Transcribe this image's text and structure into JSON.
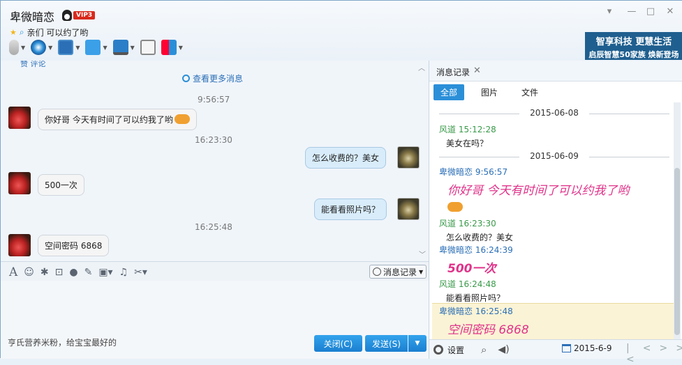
{
  "window": {
    "contact_name": "卑微暗恋",
    "vip_badge": "VIP3",
    "signature": "亲们 可以约了哟",
    "controls": [
      "▾",
      "—",
      "□",
      "✕"
    ]
  },
  "toolbar": {
    "icons": [
      "microphone-icon",
      "video-call-icon",
      "screen-share-icon",
      "file-transfer-icon",
      "remote-desktop-icon",
      "add-app-icon",
      "more-apps-icon"
    ]
  },
  "ad_banner": {
    "line1": "智享科技 更慧生活",
    "line2": "启辰智慧50家族 焕新登场"
  },
  "chat": {
    "top_cut": "赞    评论",
    "view_more": "查看更多消息",
    "messages": [
      {
        "time": "9:56:57"
      },
      {
        "side": "left",
        "text": "你好哥  今天有时间了可以约我了哟"
      },
      {
        "time": "16:23:30"
      },
      {
        "side": "right",
        "text": "怎么收费的？美女"
      },
      {
        "side": "left",
        "text": "500一次"
      },
      {
        "side": "right",
        "text": "能看看照片吗？"
      },
      {
        "time": "16:25:48"
      },
      {
        "side": "left",
        "text": "空间密码  6868"
      }
    ]
  },
  "input_toolbar": {
    "icons": [
      "font-icon",
      "emoji-icon",
      "magic-icon",
      "screenshot-icon",
      "voice-icon",
      "edit-icon",
      "image-icon",
      "music-icon",
      "scissors-icon"
    ],
    "history_button": "消息记录"
  },
  "input_area": {
    "ad_text": "亨氏营养米粉，给宝宝最好的",
    "close_button": "关闭(C)",
    "send_button": "发送(S)"
  },
  "history_panel": {
    "tab_label": "消息记录",
    "filters": [
      "全部",
      "图片",
      "文件"
    ],
    "entries": [
      {
        "type": "date",
        "text": "2015-06-08"
      },
      {
        "type": "name",
        "color": "green",
        "text": "风道 15:12:28"
      },
      {
        "type": "msg",
        "text": "美女在吗？"
      },
      {
        "type": "date",
        "text": "2015-06-09"
      },
      {
        "type": "name",
        "color": "blue",
        "text": "卑微暗恋 9:56:57"
      },
      {
        "type": "big",
        "text": "你好哥 今天有时间了可以约我了哟"
      },
      {
        "type": "name",
        "color": "green",
        "text": "风道 16:23:30"
      },
      {
        "type": "msg",
        "text": "怎么收费的？美女"
      },
      {
        "type": "name",
        "color": "blue",
        "text": "卑微暗恋 16:24:39"
      },
      {
        "type": "big",
        "text": "500一次"
      },
      {
        "type": "name",
        "color": "green",
        "text": "风道 16:24:48"
      },
      {
        "type": "msg",
        "text": "能看看照片吗？"
      },
      {
        "type": "name",
        "color": "blue",
        "text": "卑微暗恋 16:25:48"
      },
      {
        "type": "big",
        "text": "空间密码 6868"
      }
    ],
    "settings_label": "设置",
    "date_value": "2015-6-9"
  }
}
